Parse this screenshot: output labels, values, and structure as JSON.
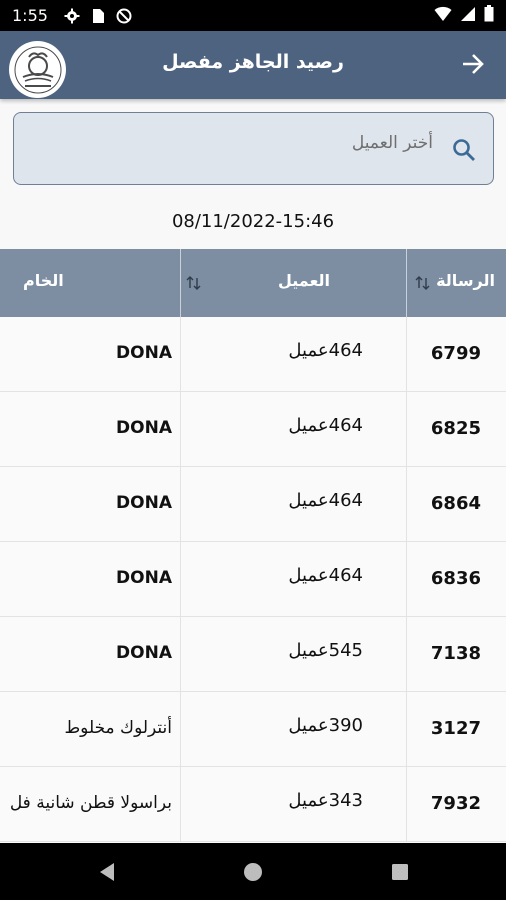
{
  "status_bar": {
    "time": "1:55",
    "icons_left": [
      "gear-icon",
      "sim-card-icon",
      "do-not-disturb-icon"
    ],
    "icons_right": [
      "wifi-icon",
      "signal-icon",
      "battery-icon"
    ]
  },
  "app_bar": {
    "title": "رصيد الجاهز مفصل",
    "back_icon": "arrow-right-icon",
    "logo_icon": "company-logo"
  },
  "search": {
    "placeholder": "أختر العميل",
    "icon": "search-icon"
  },
  "timestamp": "08/11/2022-15:46",
  "table": {
    "columns": [
      {
        "key": "message",
        "label": "الرسالة",
        "sortable": true
      },
      {
        "key": "customer",
        "label": "العميل",
        "sortable": true
      },
      {
        "key": "raw",
        "label": "الخام",
        "sortable": false
      }
    ],
    "rows": [
      {
        "message": "6799",
        "customer": "464عميل",
        "raw": "DONA"
      },
      {
        "message": "6825",
        "customer": "464عميل",
        "raw": "DONA"
      },
      {
        "message": "6864",
        "customer": "464عميل",
        "raw": "DONA"
      },
      {
        "message": "6836",
        "customer": "464عميل",
        "raw": "DONA"
      },
      {
        "message": "7138",
        "customer": "545عميل",
        "raw": "DONA"
      },
      {
        "message": "3127",
        "customer": "390عميل",
        "raw": "أنترلوك مخلوط"
      },
      {
        "message": "7932",
        "customer": "343عميل",
        "raw": "براسولا قطن شانية فل"
      }
    ]
  },
  "colors": {
    "app_bar": "#4d6380",
    "table_header": "#7d8ea3",
    "search_bg": "#dfe5ec"
  }
}
